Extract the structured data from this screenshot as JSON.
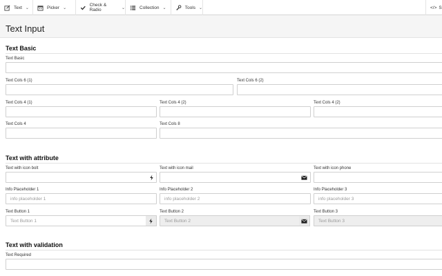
{
  "nav": {
    "items": [
      {
        "label": "Text",
        "icon": "pencil-square-icon"
      },
      {
        "label": "Picker",
        "icon": "calendar-icon"
      },
      {
        "label": "Check & Radio",
        "icon": "checkmark-icon"
      },
      {
        "label": "Collection",
        "icon": "list-icon"
      },
      {
        "label": "Tools",
        "icon": "wrench-icon"
      }
    ],
    "right_label": "S"
  },
  "page": {
    "title": "Text Input"
  },
  "sections": {
    "basic": {
      "title": "Text Basic",
      "labels": {
        "text_basic": "Text Basic",
        "cols6_1": "Text Cols 6 (1)",
        "cols6_2": "Text Cols 6 (2)",
        "cols4_1": "Text Cols 4 (1)",
        "cols4_2": "Text Cols 4 (2)",
        "cols4_3": "Text Cols 4 (2)",
        "cols4": "Text Cols 4",
        "cols8": "Text Cols 8"
      }
    },
    "attribute": {
      "title": "Text with attribute",
      "labels": {
        "icon_bolt": "Text with icon bolt",
        "icon_mail": "Text with icon mail",
        "icon_phone": "Text with icon phone",
        "info1": "Info Placeholder 1",
        "info2": "Info Placeholder 2",
        "info3": "Info Placeholder 3",
        "button1": "Text Button 1",
        "button2": "Text Button 2",
        "button3": "Text Button 3"
      },
      "placeholders": {
        "info1": "info placeholder 1",
        "info2": "info placeholder 2",
        "info3": "info placeholder 3",
        "button1": "Text Button 1",
        "button2": "Text Button 2",
        "button3": "Text Button 3"
      }
    },
    "validation": {
      "title": "Text with validation",
      "labels": {
        "required": "Text Required"
      }
    }
  }
}
